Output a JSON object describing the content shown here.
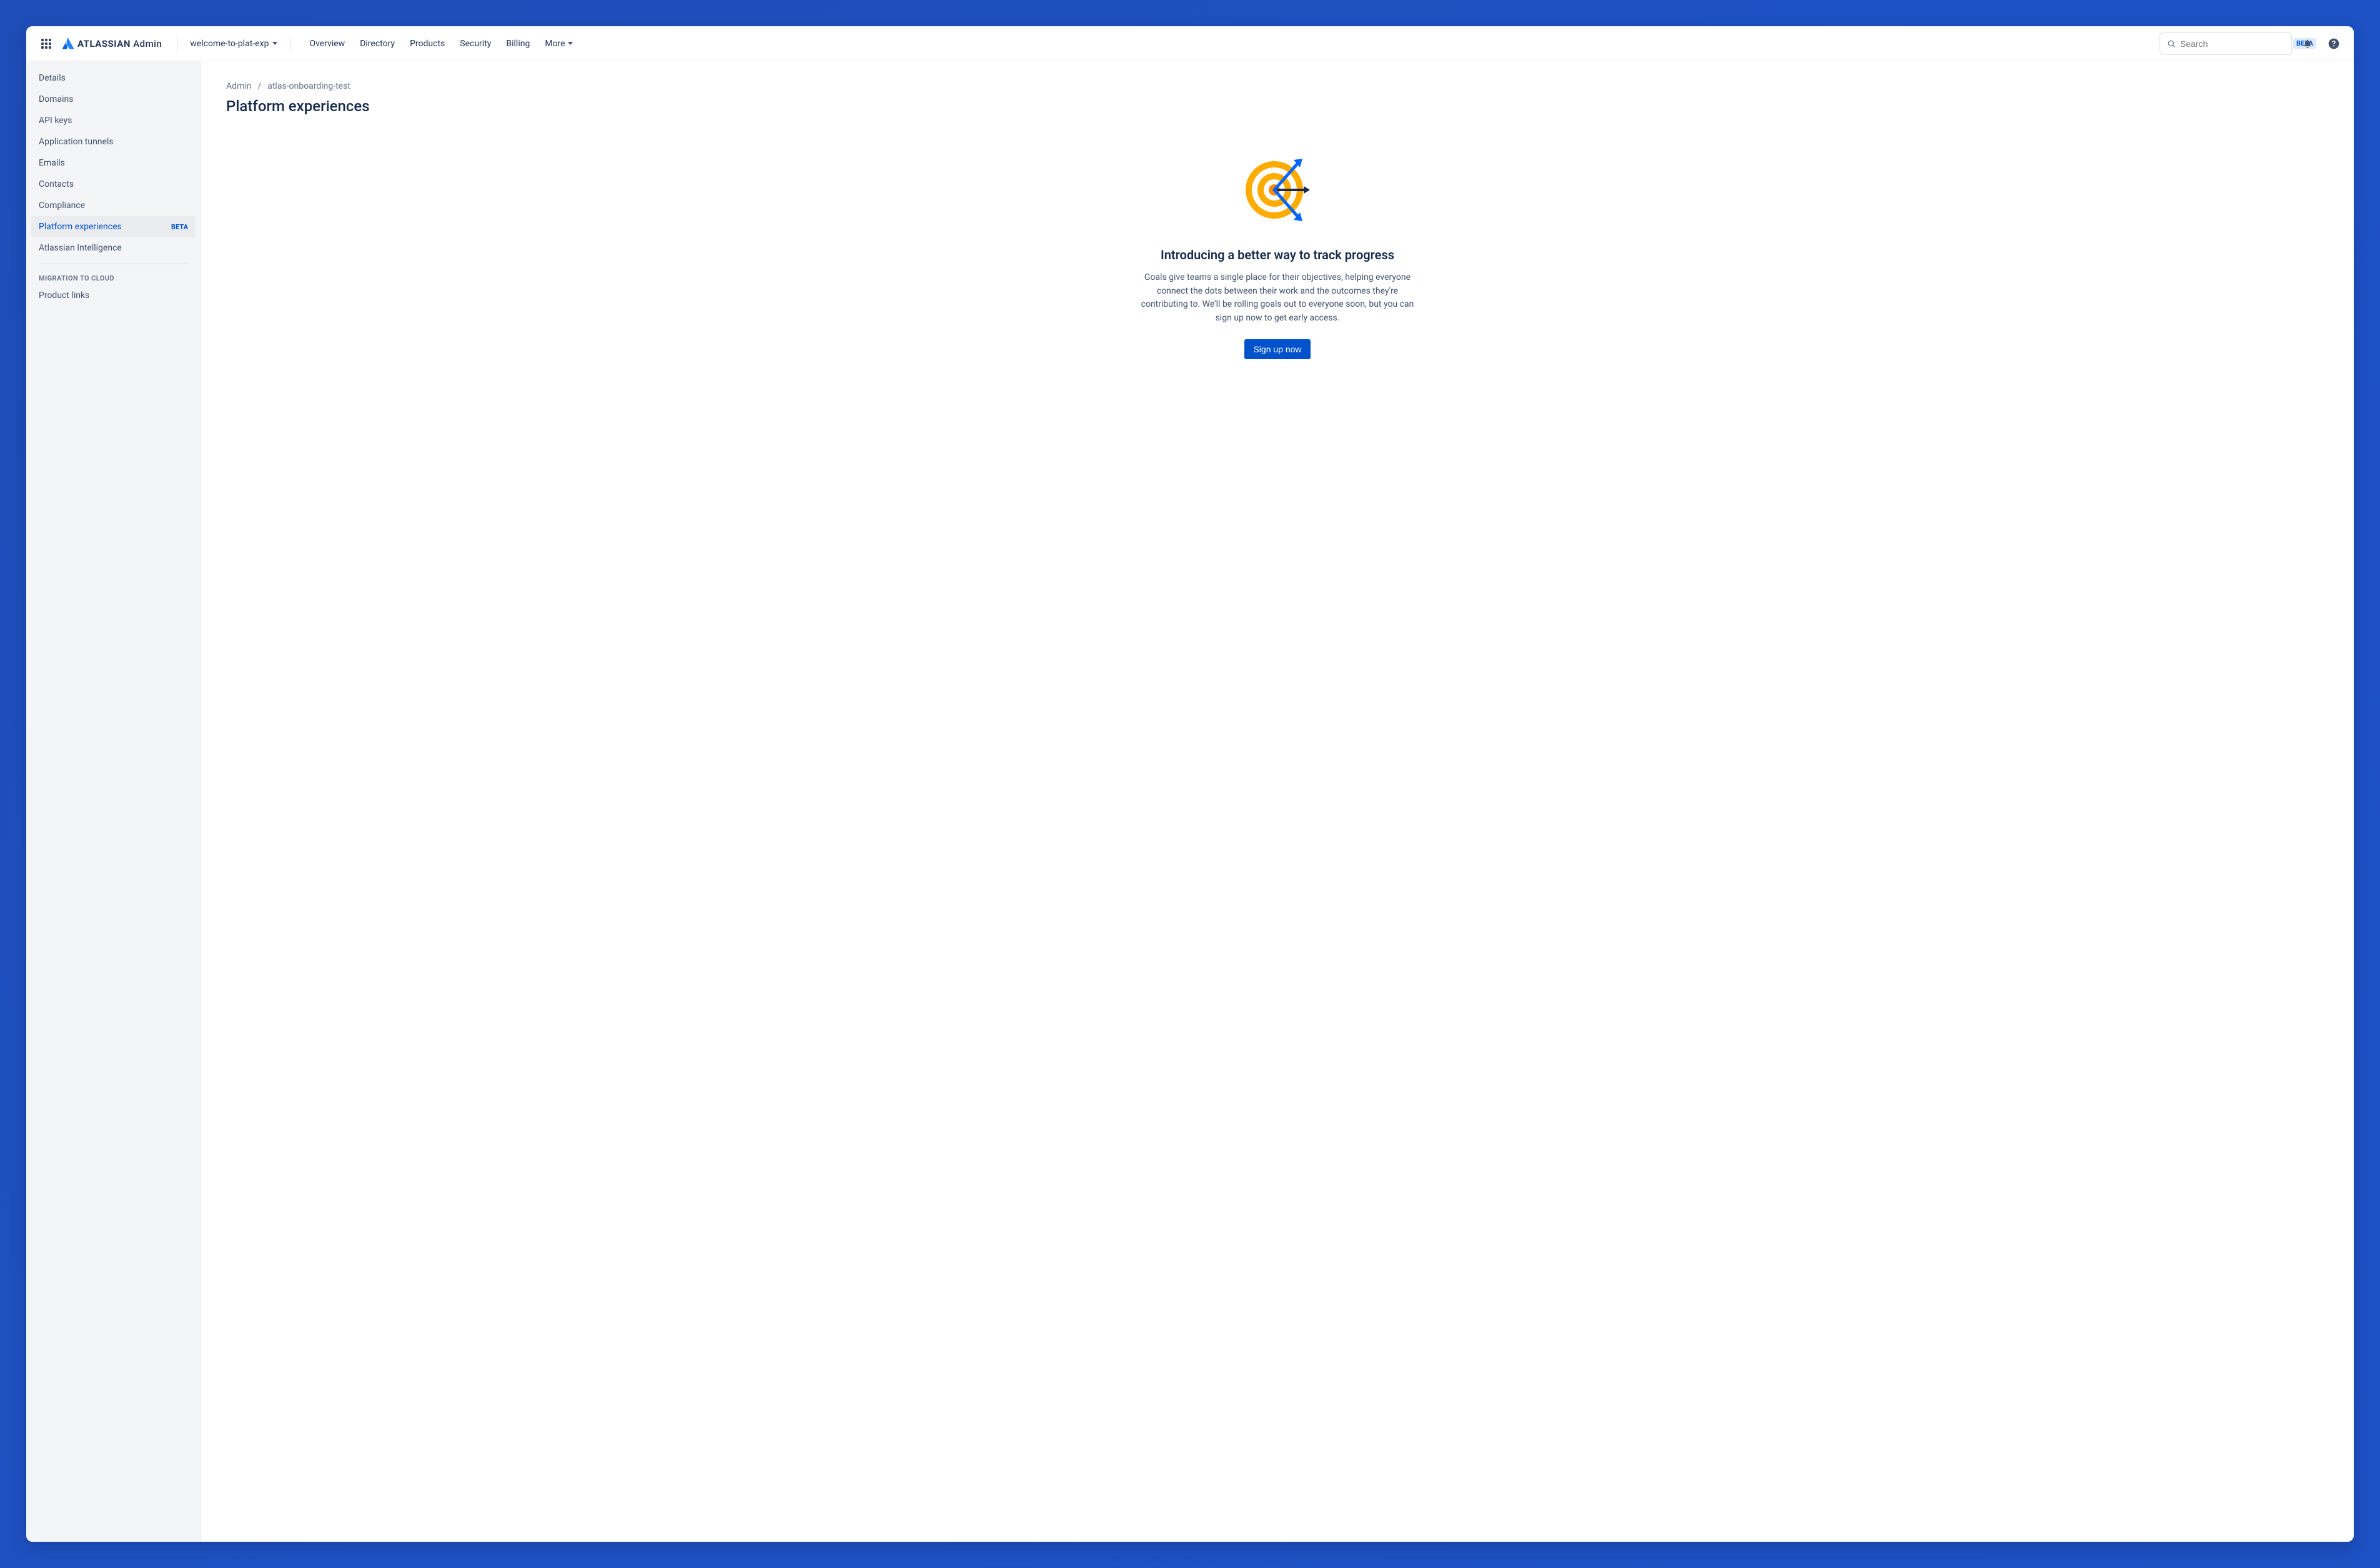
{
  "brand": {
    "name": "ATLASSIAN",
    "suffix": "Admin",
    "accent": "#0052CC"
  },
  "org_switcher": {
    "label": "welcome-to-plat-exp"
  },
  "nav": {
    "items": [
      {
        "label": "Overview"
      },
      {
        "label": "Directory"
      },
      {
        "label": "Products"
      },
      {
        "label": "Security"
      },
      {
        "label": "Billing"
      }
    ],
    "more_label": "More"
  },
  "search": {
    "placeholder": "Search",
    "badge": "BETA"
  },
  "sidebar": {
    "items": [
      {
        "label": "Details",
        "active": false
      },
      {
        "label": "Domains",
        "active": false
      },
      {
        "label": "API keys",
        "active": false
      },
      {
        "label": "Application tunnels",
        "active": false
      },
      {
        "label": "Emails",
        "active": false
      },
      {
        "label": "Contacts",
        "active": false
      },
      {
        "label": "Compliance",
        "active": false
      },
      {
        "label": "Platform experiences",
        "active": true,
        "badge": "BETA"
      },
      {
        "label": "Atlassian Intelligence",
        "active": false
      }
    ],
    "section2_heading": "MIGRATION TO CLOUD",
    "section2_items": [
      {
        "label": "Product links"
      }
    ]
  },
  "breadcrumb": {
    "root": "Admin",
    "current": "atlas-onboarding-test"
  },
  "page": {
    "title": "Platform experiences",
    "hero_title": "Introducing a better way to track progress",
    "hero_desc": "Goals give teams a single place for their objectives, helping everyone connect the dots between their work and the outcomes they're contributing to. We'll be rolling goals out to everyone soon, but you can sign up now to get early access.",
    "cta": "Sign up now"
  }
}
